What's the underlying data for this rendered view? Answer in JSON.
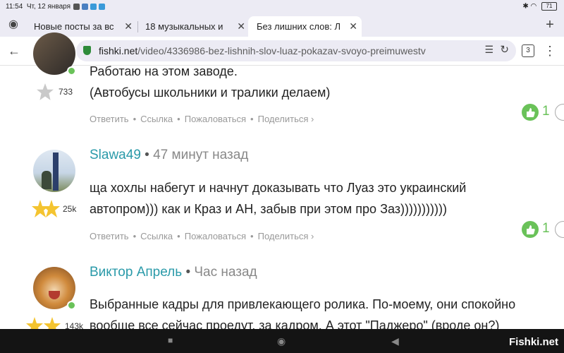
{
  "status_bar": {
    "time": "11:54",
    "date": "Чт, 12 января",
    "battery": "71"
  },
  "tabs": [
    {
      "label": "Новые посты за вс"
    },
    {
      "label": "18 музыкальных и"
    },
    {
      "label": "Без лишних слов: Л"
    }
  ],
  "browser": {
    "domain": "fishki.net",
    "path": "/video/4336986-bez-lishnih-slov-luaz-pokazav-svoyo-preimuwestv",
    "tab_count": "3"
  },
  "comments": [
    {
      "user": "",
      "time": "",
      "rating": "733",
      "lines": [
        "Работаю на этом заводе.",
        "(Автобусы школьники и тралики делаем)"
      ],
      "likes": "1"
    },
    {
      "user": "Slawa49",
      "time": "47 минут назад",
      "rating": "25k",
      "lines": [
        "ща хохлы набегут и начнут доказывать что Луаз это украинский",
        "автопром))) как и Краз и АН, забыв при этом про Заз)))))))))))"
      ],
      "likes": "1"
    },
    {
      "user": "Виктор Апрель",
      "time": "Час назад",
      "rating": "143k",
      "lines": [
        "Выбранные кадры для привлекающего ролика. По-моему, они спокойно",
        "вообще все сейчас проедут, за кадром. А этот \"Паджеро\" (вроде он?)"
      ],
      "likes": ""
    }
  ],
  "actions": {
    "reply": "Ответить",
    "link": "Ссылка",
    "report": "Пожаловаться",
    "share": "Поделиться ›"
  },
  "watermark": "Fishki.net",
  "colors": {
    "username": "#2a9aa9",
    "like": "#6ac259",
    "star_gold": "#f4c430"
  }
}
